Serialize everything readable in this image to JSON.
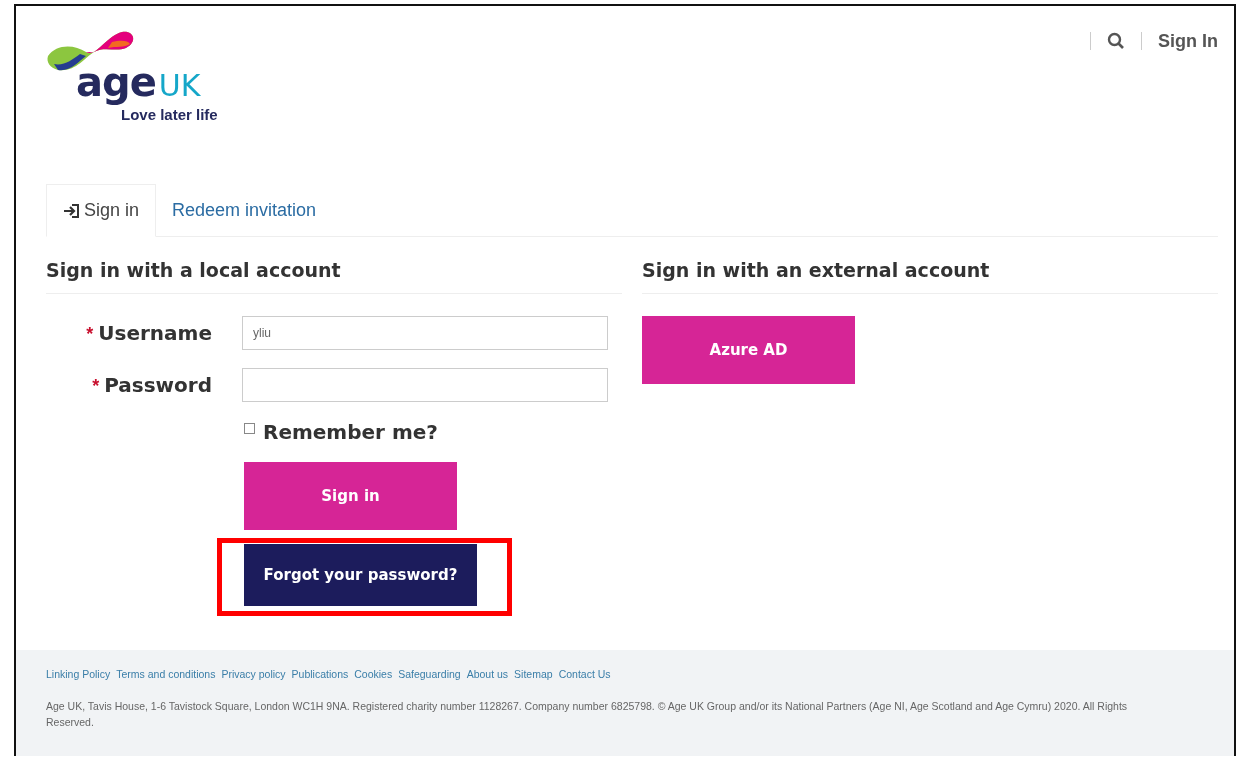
{
  "header": {
    "logo": {
      "word": "age",
      "accent": "UK",
      "tagline": "Love later life"
    },
    "sign_in_link": "Sign In"
  },
  "tabs": [
    {
      "label": "Sign in",
      "selected": true
    },
    {
      "label": "Redeem invitation",
      "selected": false
    }
  ],
  "local": {
    "heading": "Sign in with a local account",
    "fields": [
      {
        "label": "Username",
        "required_mark": "*",
        "value": "yliu"
      },
      {
        "label": "Password",
        "required_mark": "*"
      }
    ],
    "remember": {
      "label": "Remember me?",
      "checked": false
    },
    "submit": "Sign in",
    "forgot": "Forgot your password?",
    "forgot_highlighted": true
  },
  "external": {
    "heading": "Sign in with an external account",
    "providers": [
      "Azure AD"
    ]
  },
  "footer": {
    "links": [
      "Linking Policy",
      "Terms and conditions",
      "Privacy policy",
      "Publications",
      "Cookies",
      "Safeguarding",
      "About us",
      "Sitemap",
      "Contact Us"
    ],
    "legal": "Age UK, Tavis House, 1-6 Tavistock Square, London WC1H 9NA. Registered charity number 1128267. Company number 6825798. © Age UK Group and/or its National Partners (Age NI, Age Scotland and Age Cymru) 2020. All Rights Reserved."
  }
}
